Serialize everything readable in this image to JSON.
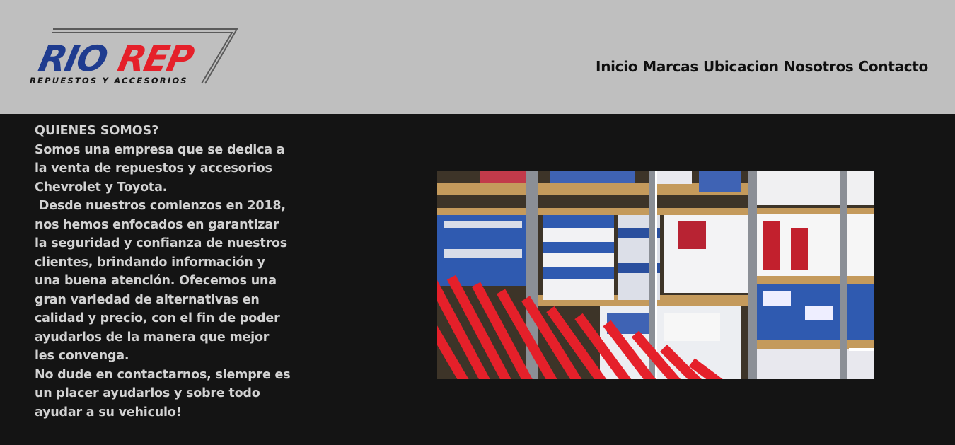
{
  "header": {
    "logo": {
      "brand_part1": "RIO",
      "brand_part2": "REP",
      "tagline": "REPUESTOS Y ACCESORIOS",
      "colors": {
        "blue": "#1f3c8f",
        "red": "#e5202a",
        "stripe": "#5a5a5a"
      }
    },
    "nav": [
      {
        "label": "Inicio"
      },
      {
        "label": "Marcas"
      },
      {
        "label": "Ubicacion"
      },
      {
        "label": "Nosotros"
      },
      {
        "label": "Contacto"
      }
    ]
  },
  "about": {
    "title": "QUIENES SOMOS?",
    "text": "Somos una empresa que se dedica a\nla venta de repuestos y accesorios\nChevrolet y Toyota.\n Desde nuestros comienzos en 2018,\nnos hemos enfocados en garantizar\nla seguridad y confianza de nuestros\nclientes, brindando información y\nuna buena atención. Ofecemos una\ngran variedad de alternativas en\ncalidad y precio, con el fin de poder\nayudarlos de la manera que mejor\nles convenga.\nNo dude en contactarnos, siempre es\nun placer ayudarlos y sobre todo\nayudar a su vehiculo!"
  },
  "colors": {
    "header_bg": "#bfbfbf",
    "page_bg": "#141414",
    "text": "#d2d2d2",
    "accent_red": "#e5202a"
  }
}
